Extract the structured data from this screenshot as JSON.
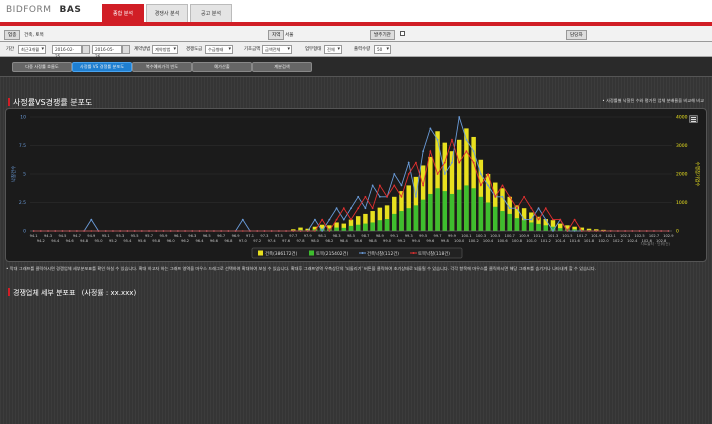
{
  "header": {
    "logo": "BIDFORM",
    "app": "BAS",
    "tabs": [
      {
        "label": "종합 분석",
        "active": true
      },
      {
        "label": "경쟁사 분석",
        "active": false
      },
      {
        "label": "공고 분석",
        "active": false
      }
    ]
  },
  "info": {
    "category_label": "업종",
    "category_value": "건축, 토목",
    "region_label": "지역",
    "region_value": "서울",
    "order_label": "발주기관",
    "manager_label": "담당자"
  },
  "filters": {
    "period_label": "기간",
    "period_value": "최근3개월",
    "date_from": "2016-02-25",
    "date_to": "2016-05-26",
    "contract_label": "계약방법",
    "contract_value": "계약방법",
    "competition_label": "경쟁도급",
    "competition_value": "수급형태",
    "base_label": "기초금액",
    "base_value": "금액전체",
    "gap_label": "업무형태",
    "gap_value": "전체",
    "output_label": "출력수량",
    "output_value": "50"
  },
  "buttons": [
    {
      "label": "다중 사정률 흐름도",
      "active": false
    },
    {
      "label": "사정률 VS 경쟁률 분포도",
      "active": true
    },
    {
      "label": "복수예비가격 빈도",
      "active": false
    },
    {
      "label": "예가산출",
      "active": false
    },
    {
      "label": "계분검색",
      "active": false
    }
  ],
  "section1": {
    "title": "사정률VS경쟁률 분포도",
    "note": "• 사정률별 낙찰된 수와 평가된 업체 분배율을 비교해 비교"
  },
  "section2": {
    "title": "경쟁업체 세부 분포표",
    "subtitle": "(사정률 : xx.xxx)"
  },
  "footnote": "• 막대 그래프를 클릭하시면 경쟁업체 세부분포표를 확인 하실 수 있습니다. 확대 하고자 하는 그래프 영역을 마우스 드래그로 선택하여 확대하여 보실 수 있습니다. 확대후 그래프영역 우측상단의 '되돌리기' 버튼을 클릭하여 초기상태로 되돌릴 수 있습니다. 각각 항목에 마우스를 클릭하시면 해당 그래프를 숨기거나 나타내게 할 수 있습니다.",
  "icons": {
    "chart_menu": "hamburger-menu-icon",
    "calendar": "calendar-icon"
  },
  "colors": {
    "accent": "#d11e26",
    "button_active": "#1f7fd1",
    "series_building": "#e8e01f",
    "series_civil": "#3ebd2e",
    "series_building_bid": "#6a9bd8",
    "series_civil_bid": "#e03030"
  },
  "chart_data": {
    "type": "bar",
    "title": "",
    "xlabel": "",
    "ylabel_left": "낙찰건수",
    "ylabel_right": "수행참가업수",
    "y_left_ticks": [
      "10",
      "7.5",
      "5",
      "2.5",
      "0"
    ],
    "y_right_ticks": [
      "4000",
      "3000",
      "2000",
      "1000",
      "0"
    ],
    "ylim_left": [
      0,
      10
    ],
    "ylim_right": [
      0,
      4000
    ],
    "categories": [
      "94.1",
      "94.2",
      "94.3",
      "94.4",
      "94.5",
      "94.6",
      "94.7",
      "94.8",
      "94.9",
      "95.0",
      "95.1",
      "95.2",
      "95.3",
      "95.4",
      "95.5",
      "95.6",
      "95.7",
      "95.8",
      "95.9",
      "96.0",
      "96.1",
      "96.2",
      "96.3",
      "96.4",
      "96.5",
      "96.6",
      "96.7",
      "96.8",
      "96.9",
      "97.0",
      "97.1",
      "97.2",
      "97.3",
      "97.4",
      "97.5",
      "97.6",
      "97.7",
      "97.8",
      "97.9",
      "98.0",
      "98.1",
      "98.2",
      "98.3",
      "98.4",
      "98.5",
      "98.6",
      "98.7",
      "98.8",
      "98.9",
      "99.0",
      "99.1",
      "99.2",
      "99.3",
      "99.4",
      "99.5",
      "99.6",
      "99.7",
      "99.8",
      "99.9",
      "100.0",
      "100.1",
      "100.2",
      "100.3",
      "100.4",
      "100.5",
      "100.6",
      "100.7",
      "100.8",
      "100.9",
      "101.0",
      "101.1",
      "101.2",
      "101.3",
      "101.4",
      "101.5",
      "101.6",
      "101.7",
      "101.8",
      "101.9",
      "102.0",
      "102.1",
      "102.2",
      "102.3",
      "102.4",
      "102.5",
      "102.6",
      "102.7",
      "102.8",
      "102.9"
    ],
    "series": [
      {
        "name": "건축(386172건)",
        "type": "bar",
        "axis": "right",
        "values": [
          0,
          0,
          0,
          0,
          0,
          0,
          0,
          0,
          0,
          0,
          0,
          0,
          0,
          0,
          0,
          0,
          0,
          0,
          0,
          0,
          0,
          0,
          0,
          0,
          0,
          0,
          0,
          0,
          0,
          0,
          0,
          0,
          0,
          0,
          0,
          0,
          60,
          120,
          80,
          150,
          220,
          200,
          300,
          260,
          400,
          520,
          600,
          700,
          820,
          900,
          1200,
          1400,
          1600,
          1900,
          2300,
          2600,
          3500,
          3100,
          2800,
          3200,
          3600,
          3300,
          2500,
          2000,
          1700,
          1500,
          1200,
          900,
          800,
          650,
          500,
          420,
          380,
          260,
          200,
          150,
          120,
          80,
          60,
          40,
          20,
          15,
          10,
          0,
          0,
          0,
          0,
          0,
          0
        ]
      },
      {
        "name": "토목(215402건)",
        "type": "bar",
        "axis": "right",
        "values": [
          0,
          0,
          0,
          0,
          0,
          0,
          0,
          0,
          0,
          0,
          0,
          0,
          0,
          0,
          0,
          0,
          0,
          0,
          0,
          0,
          0,
          0,
          0,
          0,
          0,
          0,
          0,
          0,
          0,
          0,
          0,
          0,
          0,
          0,
          0,
          0,
          20,
          40,
          30,
          60,
          80,
          90,
          120,
          110,
          180,
          220,
          260,
          300,
          380,
          420,
          600,
          700,
          800,
          900,
          1100,
          1300,
          1500,
          1400,
          1300,
          1450,
          1600,
          1500,
          1200,
          1000,
          850,
          700,
          600,
          450,
          380,
          300,
          250,
          200,
          150,
          100,
          80,
          60,
          40,
          30,
          20,
          10,
          5,
          0,
          0,
          0,
          0,
          0,
          0,
          0,
          0
        ]
      },
      {
        "name": "건축낙찰(112건)",
        "type": "line",
        "axis": "left",
        "values": [
          0,
          0,
          0,
          0,
          0,
          0,
          0,
          0,
          1,
          0,
          0,
          0,
          0,
          0,
          0,
          0,
          0,
          0,
          0,
          0,
          0,
          0,
          0,
          0,
          0,
          0,
          0,
          0,
          0,
          1,
          0,
          0,
          0,
          0,
          0,
          0,
          0,
          0,
          0,
          1,
          0,
          1,
          2,
          1,
          2,
          3,
          2,
          4,
          3,
          3,
          5,
          4,
          6,
          3,
          7,
          9,
          8,
          5,
          6,
          10,
          8,
          7,
          5,
          4,
          3,
          3,
          2,
          2,
          1,
          1,
          2,
          1,
          0,
          1,
          0,
          0,
          0,
          0,
          0,
          0,
          0,
          0,
          0,
          0,
          0,
          0,
          0,
          0,
          0
        ]
      },
      {
        "name": "토목낙찰(118건)",
        "type": "line",
        "axis": "left",
        "values": [
          0,
          0,
          0,
          0,
          0,
          0,
          0,
          0,
          0,
          0,
          0,
          0,
          0,
          0,
          0,
          0,
          0,
          0,
          0,
          0,
          0,
          0,
          0,
          0,
          0,
          0,
          0,
          0,
          0,
          0,
          0,
          0,
          0,
          0,
          0,
          0,
          0,
          0,
          0,
          0,
          1,
          0,
          1,
          2,
          1,
          2,
          3,
          2,
          4,
          3,
          4,
          3,
          5,
          6,
          4,
          7,
          5,
          6,
          8,
          6,
          7,
          6,
          4,
          5,
          3,
          4,
          3,
          2,
          3,
          2,
          1,
          2,
          1,
          1,
          0,
          1,
          0,
          0,
          0,
          0,
          0,
          0,
          0,
          0,
          0,
          0,
          0,
          0,
          0
        ]
      }
    ],
    "legend_position": "bottom",
    "grid": true,
    "credits": "차트출처 · 단위(건)"
  }
}
